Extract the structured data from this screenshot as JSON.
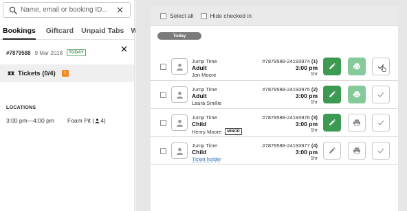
{
  "search": {
    "placeholder": "Name, email or booking ID..."
  },
  "tabs": [
    {
      "label": "Bookings",
      "active": true
    },
    {
      "label": "Giftcard",
      "active": false
    },
    {
      "label": "Unpaid Tabs",
      "active": false
    },
    {
      "label": "Waiver",
      "active": false
    }
  ],
  "booking": {
    "id": "#7879588",
    "date": "9 Mar 2018",
    "badge": "TODAY",
    "tickets_label": "Tickets (0/4)",
    "tickets_badge": "!"
  },
  "locations": {
    "title": "LOCATIONS",
    "rows": [
      {
        "time": "3:00 pm—4:00 pm",
        "place": "Foam Pit (",
        "count": "4)"
      }
    ]
  },
  "toolbar": {
    "select_all": "Select all",
    "hide_checked_in": "Hide checked in"
  },
  "group_label": "Today",
  "tickets": [
    {
      "event": "Jump Time",
      "type": "Adult",
      "holder": "Jon Moore",
      "holder_link": false,
      "minor": false,
      "ref": "#7879588-24193974",
      "index": "(1)",
      "time": "3:00 pm",
      "duration": "1hr",
      "state": "checked-in"
    },
    {
      "event": "Jump Time",
      "type": "Adult",
      "holder": "Laura Smillie",
      "holder_link": false,
      "minor": false,
      "ref": "#7879588-24193975",
      "index": "(2)",
      "time": "3:00 pm",
      "duration": "1hr",
      "state": "checked-in"
    },
    {
      "event": "Jump Time",
      "type": "Child",
      "holder": "Henry Moore",
      "holder_link": false,
      "minor": true,
      "minor_label": "MINOR",
      "ref": "#7879588-24193976",
      "index": "(3)",
      "time": "3:00 pm",
      "duration": "1hr",
      "state": "edited"
    },
    {
      "event": "Jump Time",
      "type": "Child",
      "holder": "Ticket holder",
      "holder_link": true,
      "minor": false,
      "ref": "#7879588-24193977",
      "index": "(4)",
      "time": "3:00 pm",
      "duration": "1hr",
      "state": "empty"
    }
  ],
  "colors": {
    "green": "#3d9a52",
    "light_green": "#86c99a",
    "orange": "#f08a24",
    "today_pill": "#7a7a7a"
  }
}
